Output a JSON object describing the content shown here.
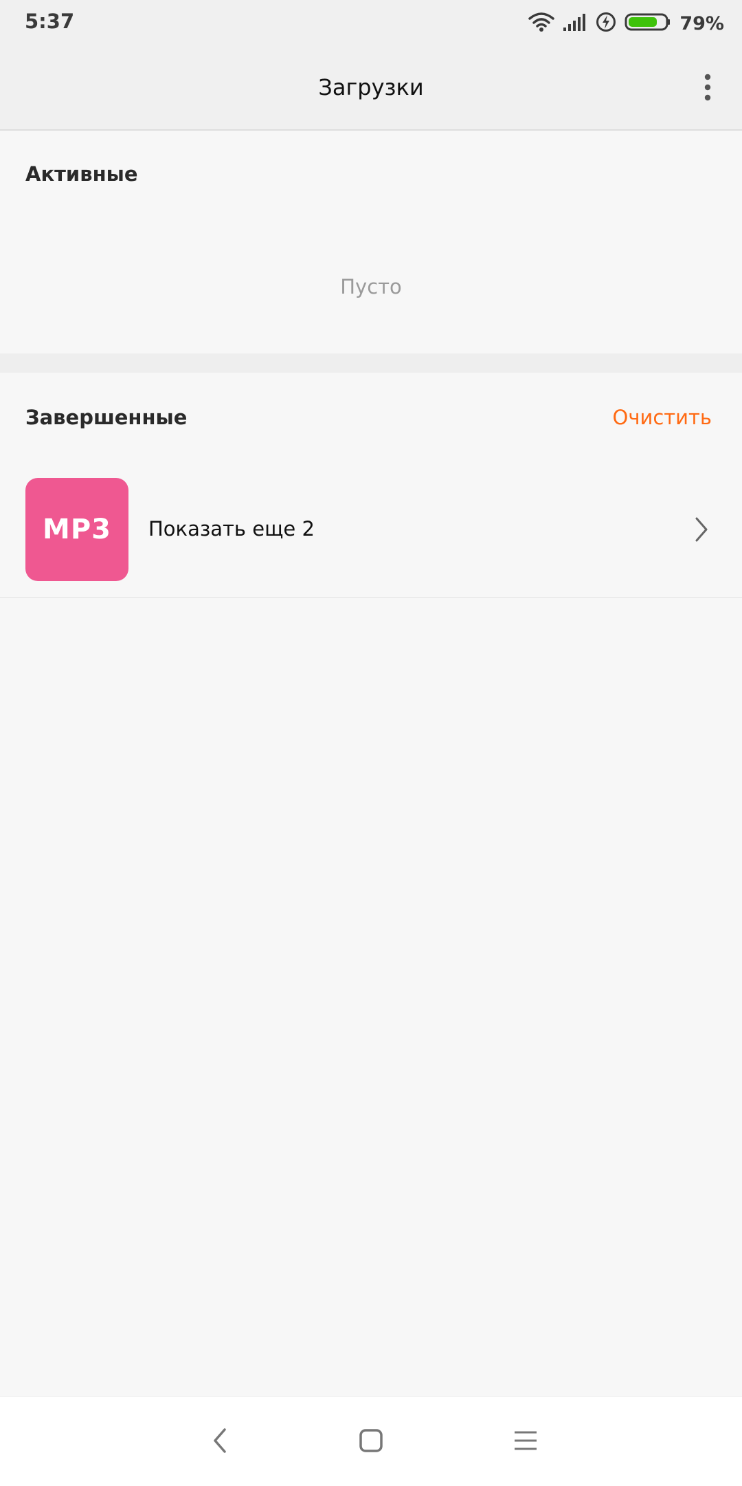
{
  "status_bar": {
    "time": "5:37",
    "battery_percent": "79%",
    "battery_level": 0.79,
    "icons": [
      "wifi-icon",
      "signal-icon",
      "charging-icon",
      "battery-icon"
    ],
    "battery_color": "#3ec20a"
  },
  "app_bar": {
    "title": "Загрузки",
    "menu_icon": "more-vert-icon"
  },
  "active_section": {
    "title": "Активные",
    "empty_text": "Пусто"
  },
  "completed_section": {
    "title": "Завершенные",
    "clear_label": "Очистить",
    "accent_color": "#ff6a13",
    "items": [
      {
        "thumb_label": "MP3",
        "thumb_color": "#ef5891",
        "label": "Показать еще 2",
        "icon": "chevron-right-icon"
      }
    ]
  },
  "nav_bar": {
    "buttons": [
      "back-icon",
      "home-icon",
      "menu-icon"
    ]
  }
}
